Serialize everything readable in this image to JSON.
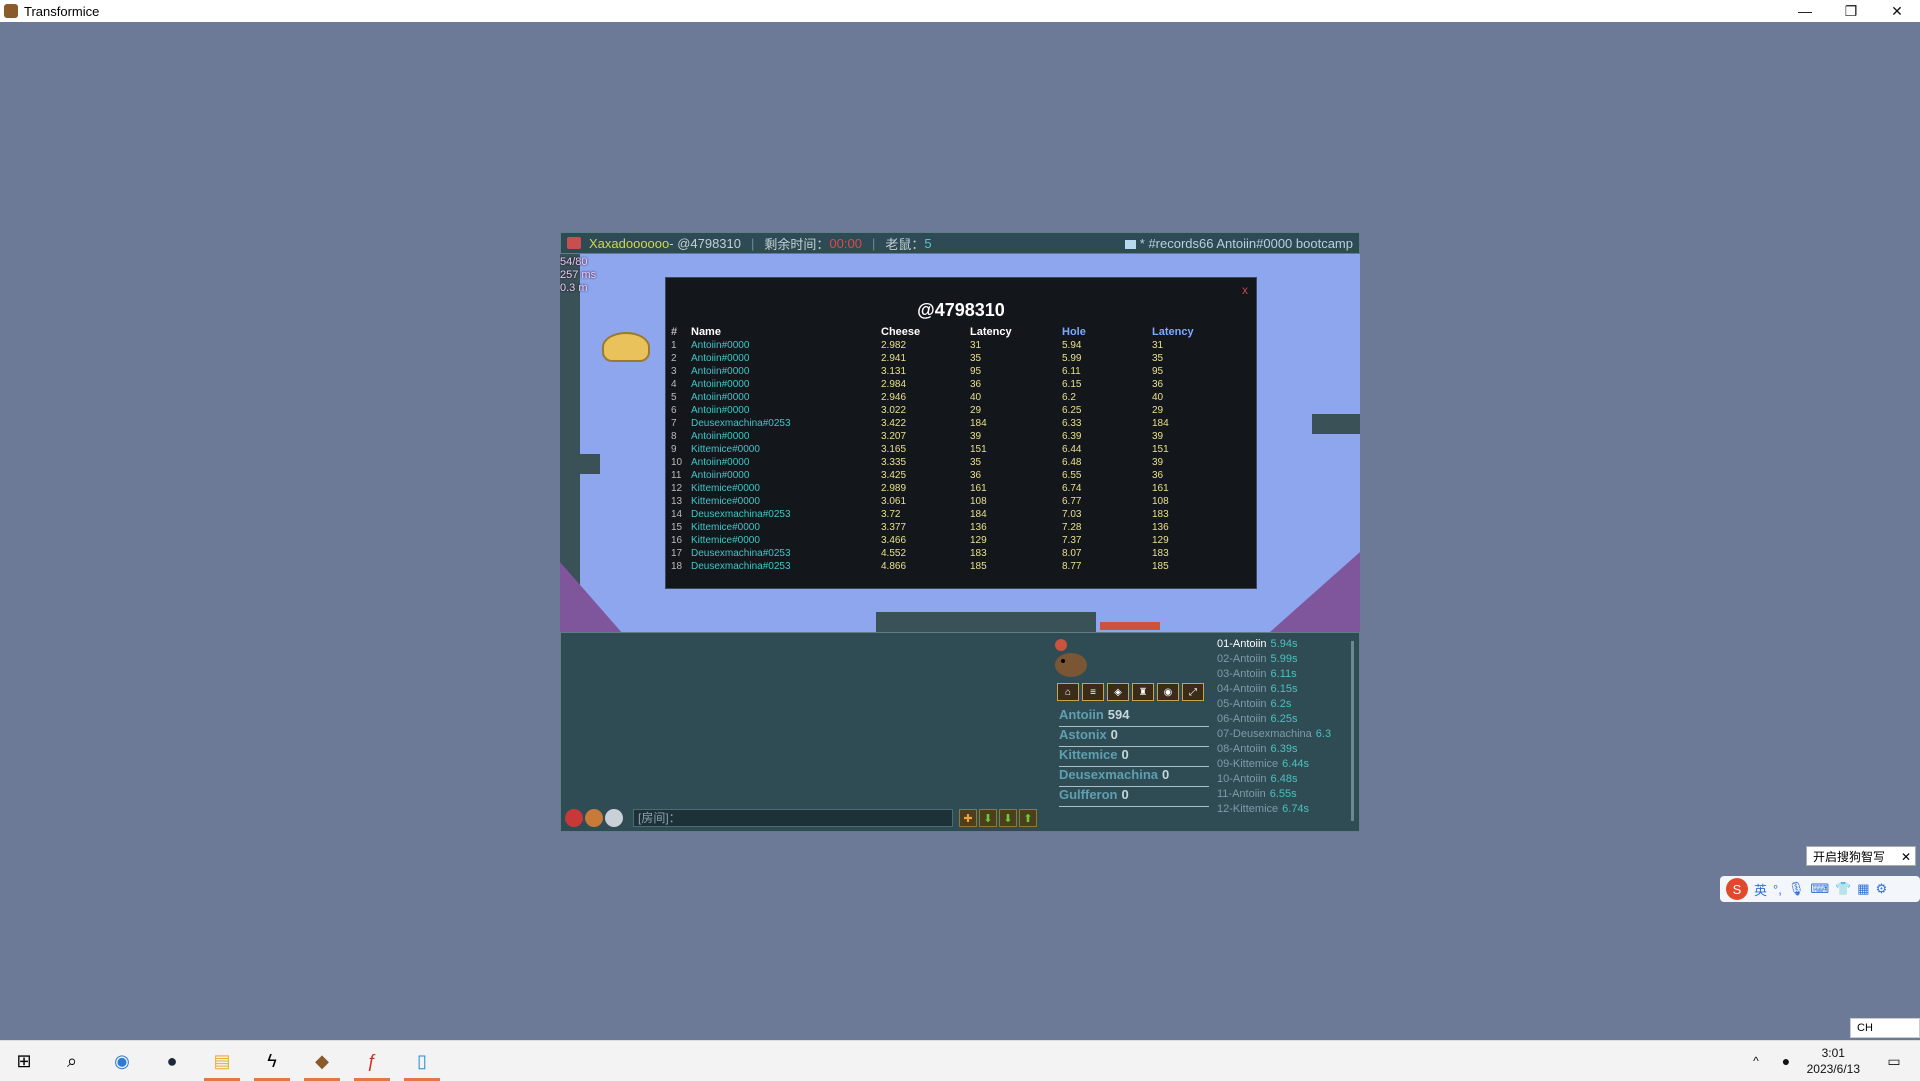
{
  "window": {
    "title": "Transformice",
    "controls": [
      "—",
      "❐",
      "✕"
    ]
  },
  "topbar": {
    "nick": "Xaxadoooooo",
    "tag": " - @4798310",
    "timer_label": "剩余时间：",
    "timer_value": "00:00",
    "limit_label": "老鼠：",
    "limit_value": "5",
    "room": "* #records66 Antoiin#0000 bootcamp"
  },
  "stats": [
    "54/80",
    "257 ms",
    "0.3 m"
  ],
  "scoreboard": {
    "title": "@4798310",
    "close": "x",
    "headers": [
      "#",
      "Name",
      "Cheese",
      "Latency",
      "Hole",
      "Latency"
    ],
    "rows": [
      [
        "1",
        "Antoiin#0000",
        "2.982",
        "31",
        "5.94",
        "31"
      ],
      [
        "2",
        "Antoiin#0000",
        "2.941",
        "35",
        "5.99",
        "35"
      ],
      [
        "3",
        "Antoiin#0000",
        "3.131",
        "95",
        "6.11",
        "95"
      ],
      [
        "4",
        "Antoiin#0000",
        "2.984",
        "36",
        "6.15",
        "36"
      ],
      [
        "5",
        "Antoiin#0000",
        "2.946",
        "40",
        "6.2",
        "40"
      ],
      [
        "6",
        "Antoiin#0000",
        "3.022",
        "29",
        "6.25",
        "29"
      ],
      [
        "7",
        "Deusexmachina#0253",
        "3.422",
        "184",
        "6.33",
        "184"
      ],
      [
        "8",
        "Antoiin#0000",
        "3.207",
        "39",
        "6.39",
        "39"
      ],
      [
        "9",
        "Kittemice#0000",
        "3.165",
        "151",
        "6.44",
        "151"
      ],
      [
        "10",
        "Antoiin#0000",
        "3.335",
        "35",
        "6.48",
        "39"
      ],
      [
        "11",
        "Antoiin#0000",
        "3.425",
        "36",
        "6.55",
        "36"
      ],
      [
        "12",
        "Kittemice#0000",
        "2.989",
        "161",
        "6.74",
        "161"
      ],
      [
        "13",
        "Kittemice#0000",
        "3.061",
        "108",
        "6.77",
        "108"
      ],
      [
        "14",
        "Deusexmachina#0253",
        "3.72",
        "184",
        "7.03",
        "183"
      ],
      [
        "15",
        "Kittemice#0000",
        "3.377",
        "136",
        "7.28",
        "136"
      ],
      [
        "16",
        "Kittemice#0000",
        "3.466",
        "129",
        "7.37",
        "129"
      ],
      [
        "17",
        "Deusexmachina#0253",
        "4.552",
        "183",
        "8.07",
        "183"
      ],
      [
        "18",
        "Deusexmachina#0253",
        "4.866",
        "185",
        "8.77",
        "185"
      ]
    ]
  },
  "players": [
    {
      "name": "Antoiin",
      "score": "594"
    },
    {
      "name": "Astonix",
      "score": "0"
    },
    {
      "name": "Kittemice",
      "score": "0"
    },
    {
      "name": "Deusexmachina",
      "score": "0"
    },
    {
      "name": "Gulfferon",
      "score": "0"
    }
  ],
  "leaderboard": [
    {
      "name": "01-Antoiin",
      "time": "5.94s"
    },
    {
      "name": "02-Antoiin",
      "time": "5.99s"
    },
    {
      "name": "03-Antoiin",
      "time": "6.11s"
    },
    {
      "name": "04-Antoiin",
      "time": "6.15s"
    },
    {
      "name": "05-Antoiin",
      "time": "6.2s"
    },
    {
      "name": "06-Antoiin",
      "time": "6.25s"
    },
    {
      "name": "07-Deusexmachina",
      "time": "6.3"
    },
    {
      "name": "08-Antoiin",
      "time": "6.39s"
    },
    {
      "name": "09-Kittemice",
      "time": "6.44s"
    },
    {
      "name": "10-Antoiin",
      "time": "6.48s"
    },
    {
      "name": "11-Antoiin",
      "time": "6.55s"
    },
    {
      "name": "12-Kittemice",
      "time": "6.74s"
    }
  ],
  "chat": {
    "placeholder": "[房间]："
  },
  "ime": {
    "tip": "开启搜狗智写",
    "mode": "英",
    "lang": "CH"
  },
  "taskbar": {
    "time": "3:01",
    "date": "2023/6/13"
  },
  "colors": {
    "accent_red": "#e04848",
    "cyan": "#3dc8c8",
    "panel": "#2f4c54"
  }
}
